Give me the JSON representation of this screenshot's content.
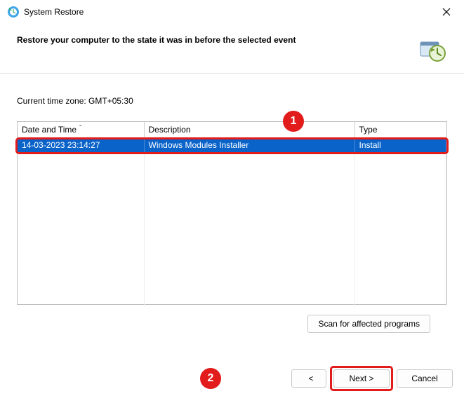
{
  "titlebar": {
    "title": "System Restore"
  },
  "header": {
    "headline": "Restore your computer to the state it was in before the selected event"
  },
  "timezone": {
    "label": "Current time zone: GMT+05:30"
  },
  "columns": {
    "date": "Date and Time",
    "desc": "Description",
    "type": "Type"
  },
  "rows": [
    {
      "date": "14-03-2023 23:14:27",
      "desc": "Windows Modules Installer",
      "type": "Install"
    }
  ],
  "buttons": {
    "scan": "Scan for affected programs",
    "back": "< ",
    "next": "Next >",
    "cancel": "Cancel"
  },
  "annotations": {
    "badge1": "1",
    "badge2": "2"
  }
}
